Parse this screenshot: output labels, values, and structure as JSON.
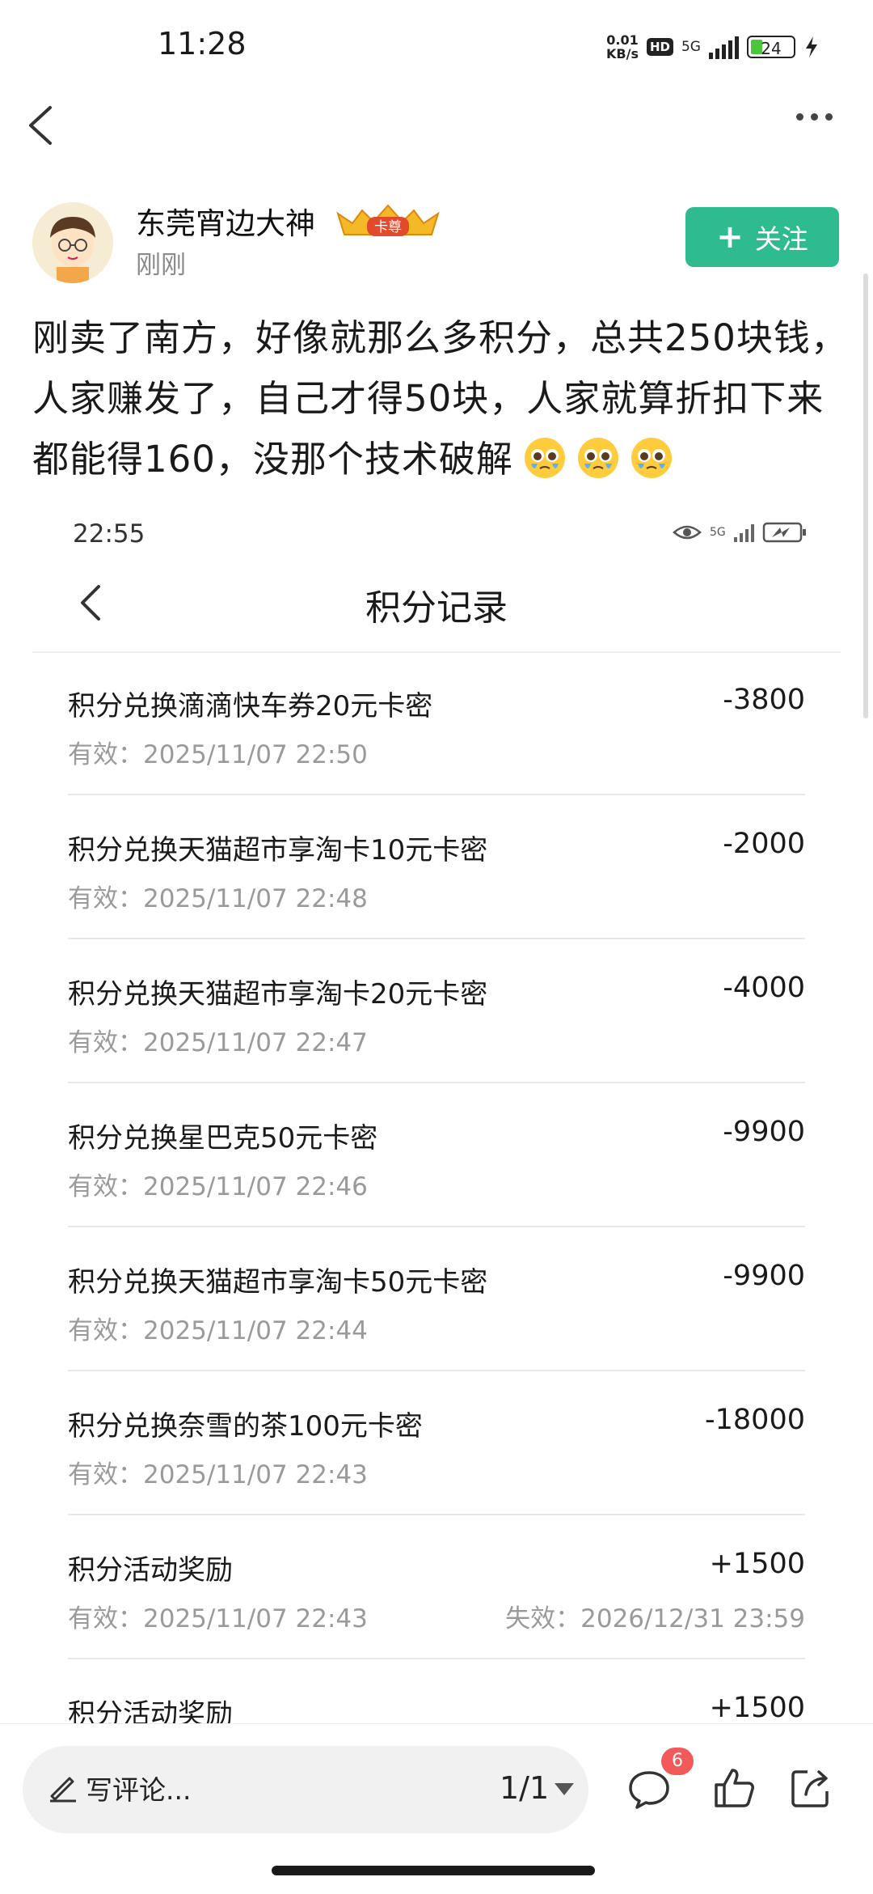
{
  "status_bar": {
    "time": "11:28",
    "speed_value": "0.01",
    "speed_unit": "KB/s",
    "hd": "HD",
    "network": "5G",
    "battery": "24"
  },
  "author": {
    "name": "东莞宵边大神",
    "badge_text": "卡尊",
    "post_time": "刚刚",
    "follow_label": "关注"
  },
  "post": {
    "text": "刚卖了南方，好像就那么多积分，总共250块钱，人家赚发了，自己才得50块，人家就算折扣下来都能得160，没那个技术破解"
  },
  "screenshot": {
    "time": "22:55",
    "network": "5G",
    "title": "积分记录",
    "records": [
      {
        "name": "积分兑换滴滴快车券20元卡密",
        "amount": "-3800",
        "valid": "有效：2025/11/07 22:50",
        "expire": ""
      },
      {
        "name": "积分兑换天猫超市享淘卡10元卡密",
        "amount": "-2000",
        "valid": "有效：2025/11/07 22:48",
        "expire": ""
      },
      {
        "name": "积分兑换天猫超市享淘卡20元卡密",
        "amount": "-4000",
        "valid": "有效：2025/11/07 22:47",
        "expire": ""
      },
      {
        "name": "积分兑换星巴克50元卡密",
        "amount": "-9900",
        "valid": "有效：2025/11/07 22:46",
        "expire": ""
      },
      {
        "name": "积分兑换天猫超市享淘卡50元卡密",
        "amount": "-9900",
        "valid": "有效：2025/11/07 22:44",
        "expire": ""
      },
      {
        "name": "积分兑换奈雪的茶100元卡密",
        "amount": "-18000",
        "valid": "有效：2025/11/07 22:43",
        "expire": ""
      },
      {
        "name": "积分活动奖励",
        "amount": "+1500",
        "valid": "有效：2025/11/07 22:43",
        "expire": "失效：2026/12/31 23:59"
      },
      {
        "name": "积分活动奖励",
        "amount": "+1500",
        "valid": "",
        "expire": ""
      }
    ]
  },
  "bottom_bar": {
    "comment_placeholder": "写评论...",
    "pager": "1/1",
    "comment_count": "6"
  },
  "icons": {
    "back": "back-arrow-icon",
    "more": "more-dots-icon",
    "follow": "plus-icon",
    "emoji": "pleading-face-emoji",
    "comment": "comment-bubble-icon",
    "like": "thumbs-up-icon",
    "share": "share-icon"
  },
  "colors": {
    "follow_button": "#2dbb8f",
    "badge": "#f25a5a",
    "battery": "#4cc63c"
  }
}
